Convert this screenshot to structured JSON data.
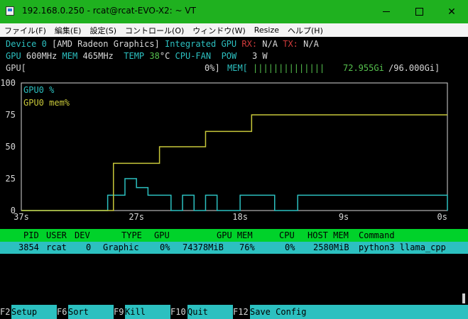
{
  "window": {
    "title": "192.168.0.250 - rcat@rcat-EVO-X2: ~ VT",
    "minimize_glyph": "—",
    "close_glyph": "✕"
  },
  "menu": [
    "ファイル(F)",
    "編集(E)",
    "設定(S)",
    "コントロール(O)",
    "ウィンドウ(W)",
    "Resize",
    "ヘルプ(H)"
  ],
  "device": {
    "device_label": "Device 0",
    "device_name": "[AMD Radeon Graphics]",
    "integrated_label": "Integrated GPU",
    "rx_label": "RX:",
    "rx_value": "N/A",
    "tx_label": "TX:",
    "tx_value": "N/A"
  },
  "clocks": {
    "gpu_label": "GPU",
    "gpu_value": "600MHz",
    "mem_label": "MEM",
    "mem_value": "465MHz",
    "temp_label": "TEMP",
    "temp_value": "38",
    "temp_unit": "°C",
    "fan_label": "CPU-FAN",
    "pow_label": "POW",
    "pow_value": "3 W"
  },
  "bars": {
    "gpu_label": "GPU[",
    "gpu_value": "0%]",
    "gpu_fraction": 0.0,
    "mem_label": "MEM[",
    "mem_fill": "||||||||||||||",
    "mem_value": "72.955Gi",
    "mem_total": "/96.000Gi]",
    "mem_fraction": 0.76
  },
  "colors": {
    "cyan": "#2cc0c0",
    "yellow": "#c8c83a",
    "green_header": "#00d22a",
    "title_green": "#1fb11f",
    "temp_green": "#56c24e",
    "red": "#d23b3b"
  },
  "chart_data": {
    "type": "line",
    "title": "",
    "ylim": [
      0,
      100
    ],
    "y_ticks": [
      "100",
      "75",
      "50",
      "25",
      "0"
    ],
    "x_ticks": [
      "37s",
      "27s",
      "18s",
      "9s",
      "0s"
    ],
    "x_range_seconds": [
      37,
      0
    ],
    "series": [
      {
        "name": "GPU0 %",
        "color": "cyan",
        "x": [
          37,
          30,
          29.5,
          29,
          28,
          27,
          26,
          24,
          23,
          22,
          21,
          20,
          19,
          18,
          15,
          14,
          13,
          0
        ],
        "values": [
          0,
          0,
          12,
          12,
          25,
          18,
          12,
          0,
          12,
          0,
          12,
          0,
          0,
          12,
          0,
          0,
          12,
          0
        ]
      },
      {
        "name": "GPU0 mem%",
        "color": "yellow",
        "x": [
          37,
          30,
          29,
          26,
          25,
          22,
          21,
          18,
          17,
          13,
          12,
          0
        ],
        "values": [
          0,
          0,
          37,
          37,
          50,
          50,
          62,
          62,
          75,
          75,
          75,
          75
        ]
      }
    ]
  },
  "processes": {
    "header": {
      "pid": "PID",
      "user": "USER",
      "dev": "DEV",
      "type": "TYPE",
      "gpu": "GPU",
      "gpu_mem": "GPU MEM",
      "cpu": "CPU",
      "host_mem": "HOST MEM",
      "command": "Command"
    },
    "rows": [
      {
        "pid": "3854",
        "user": "rcat",
        "dev": "0",
        "type": "Graphic",
        "gpu": "0%",
        "gpu_mem": "74378MiB",
        "gpu_mem_pct": "76%",
        "cpu": "0%",
        "host_mem": "2580MiB",
        "command": "python3 llama_cpp"
      }
    ]
  },
  "fkeys": [
    {
      "key": "F2",
      "label": "Setup"
    },
    {
      "key": "F6",
      "label": "Sort"
    },
    {
      "key": "F9",
      "label": "Kill"
    },
    {
      "key": "F10",
      "label": "Quit"
    },
    {
      "key": "F12",
      "label": "Save Config"
    }
  ]
}
